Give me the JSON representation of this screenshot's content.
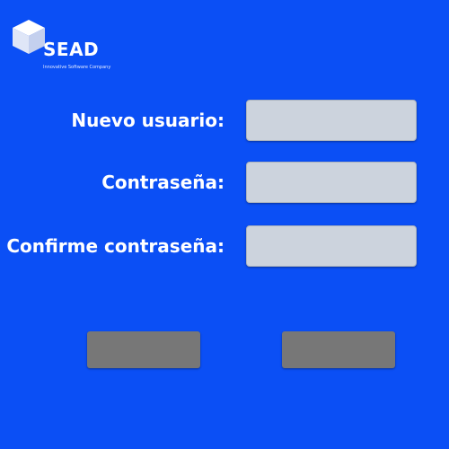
{
  "brand": {
    "logo_icon": "cube-icon",
    "name": "SEAD",
    "tagline": "Innovative Software Company"
  },
  "form": {
    "username": {
      "label": "Nuevo usuario:",
      "value": "",
      "placeholder": ""
    },
    "password": {
      "label": "Contraseña:",
      "value": "",
      "placeholder": ""
    },
    "confirm_password": {
      "label": "Confirme contraseña:",
      "value": "",
      "placeholder": ""
    }
  },
  "buttons": {
    "left_label": "",
    "right_label": ""
  },
  "colors": {
    "background": "#0b4ff5",
    "input_bg": "#ccd3dd",
    "button_bg": "#777777",
    "text": "#ffffff"
  }
}
